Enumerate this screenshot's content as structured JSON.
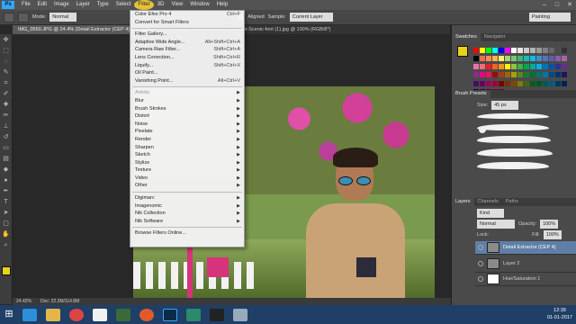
{
  "menubar": {
    "app_icon": "Ps",
    "items": [
      "File",
      "Edit",
      "Image",
      "Layer",
      "Type",
      "Select",
      "Filter",
      "3D",
      "View",
      "Window",
      "Help"
    ]
  },
  "options_bar": {
    "mode_label": "Mode:",
    "mode_value": "Normal",
    "aligned_label": "Aligned",
    "sample_label": "Sample:",
    "sample_value": "Current Layer",
    "workspace_value": "Painting"
  },
  "document_tabs": [
    {
      "label": "IMG_0560.JPG @ 24.4% (Detail Extractor (CEP 4) , RGB/8)",
      "active": true
    },
    {
      "label": "...ckground-a-font-font-a-Natural-a-font-Scenic-font (1).jpg @ 100% (RGB/8*)",
      "active": false
    }
  ],
  "filter_menu": {
    "items": [
      {
        "label": "Color Efex Pro 4",
        "shortcut": "Ctrl+F",
        "disabled": false
      },
      {
        "label": "Convert for Smart Filters",
        "shortcut": "",
        "disabled": false
      },
      {
        "sep": true
      },
      {
        "label": "Filter Gallery...",
        "shortcut": "",
        "disabled": false
      },
      {
        "label": "Adaptive Wide Angle...",
        "shortcut": "Alt+Shift+Ctrl+A",
        "disabled": false
      },
      {
        "label": "Camera Raw Filter...",
        "shortcut": "Shift+Ctrl+A",
        "disabled": false
      },
      {
        "label": "Lens Correction...",
        "shortcut": "Shift+Ctrl+R",
        "disabled": false
      },
      {
        "label": "Liquify...",
        "shortcut": "Shift+Ctrl+X",
        "disabled": false
      },
      {
        "label": "Oil Paint...",
        "shortcut": "",
        "disabled": false
      },
      {
        "label": "Vanishing Point...",
        "shortcut": "Alt+Ctrl+V",
        "disabled": false
      },
      {
        "sep": true
      },
      {
        "label": "Artistic",
        "submenu": true,
        "disabled": true
      },
      {
        "label": "Blur",
        "submenu": true,
        "disabled": false
      },
      {
        "label": "Brush Strokes",
        "submenu": true,
        "disabled": false
      },
      {
        "label": "Distort",
        "submenu": true,
        "disabled": false
      },
      {
        "label": "Noise",
        "submenu": true,
        "disabled": false
      },
      {
        "label": "Pixelate",
        "submenu": true,
        "disabled": false
      },
      {
        "label": "Render",
        "submenu": true,
        "disabled": false
      },
      {
        "label": "Sharpen",
        "submenu": true,
        "disabled": false
      },
      {
        "label": "Sketch",
        "submenu": true,
        "disabled": false
      },
      {
        "label": "Stylize",
        "submenu": true,
        "disabled": false
      },
      {
        "label": "Texture",
        "submenu": true,
        "disabled": false
      },
      {
        "label": "Video",
        "submenu": true,
        "disabled": false
      },
      {
        "label": "Other",
        "submenu": true,
        "disabled": false
      },
      {
        "sep": true
      },
      {
        "label": "Digimarc",
        "submenu": true,
        "disabled": false
      },
      {
        "label": "Imagenomic",
        "submenu": true,
        "disabled": false
      },
      {
        "label": "Nik Collection",
        "submenu": true,
        "disabled": false
      },
      {
        "label": "Nik Software",
        "submenu": true,
        "disabled": false
      },
      {
        "sep": true
      },
      {
        "label": "Browse Filters Online...",
        "shortcut": "",
        "disabled": false
      }
    ]
  },
  "status_bar": {
    "zoom": "24.42%",
    "doc": "Doc: 22.2M/114.8M"
  },
  "panels": {
    "swatches_tabs": [
      "Swatches",
      "Navigator"
    ],
    "brush_presets_title": "Brush Presets",
    "brush_size_label": "Size:",
    "brush_size_value": "45 px",
    "layers_tabs": [
      "Layers",
      "Channels",
      "Paths"
    ],
    "kind_label": "Kind",
    "blend_mode": "Normal",
    "opacity_label": "Opacity:",
    "opacity_value": "100%",
    "lock_label": "Lock:",
    "fill_label": "Fill:",
    "fill_value": "100%",
    "layers": [
      {
        "name": "Detail Extractor (CEP 4)",
        "selected": true
      },
      {
        "name": "Layer 2",
        "selected": false
      },
      {
        "name": "Hue/Saturation 1",
        "selected": false
      }
    ]
  },
  "taskbar": {
    "time": "12:39",
    "date": "01-01-2017"
  },
  "colors": {
    "accent": "#31a8ff",
    "menu_highlight": "#e6c23a",
    "selection": "#5f7fa6"
  }
}
